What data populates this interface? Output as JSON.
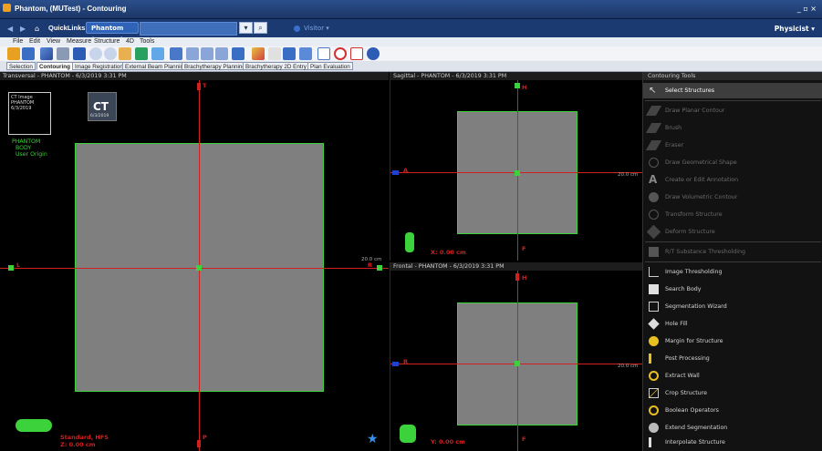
{
  "window": {
    "title": "Phantom, (MUTest) - Contouring",
    "controls": "_ ▫ ×"
  },
  "nav": {
    "quicklinks": "QuickLinks ▾",
    "patient_tab": "Phantom (MUTest)",
    "visitor": "Visitor ▾",
    "user": "Physicist ▾"
  },
  "menu": [
    "File",
    "Edit",
    "View",
    "Measure",
    "Structure",
    "4D",
    "Tools"
  ],
  "task_tabs": [
    "Selection",
    "Contouring",
    "Image Registration",
    "External Beam Planning",
    "Brachytherapy Planning",
    "Brachytherapy 2D Entry",
    "Plan Evaluation"
  ],
  "active_task_tab": "Contouring",
  "viewports": {
    "transversal": {
      "title": "Transversal - PHANTOM - 6/3/2019 3:31 PM",
      "series_thumb_1": "CT Image\nPHANTOM\n6/3/2019",
      "series_thumb_2_label": "CT",
      "series_thumb_2_date": "6/3/2019",
      "structures": [
        "PHANTOM",
        "BODY",
        "User Origin"
      ],
      "scale": "20.0 cm",
      "orientation": "Standard, HFS",
      "z_coord": "Z: 0.00 cm",
      "marker_t": "T",
      "marker_p": "P",
      "marker_l": "L",
      "marker_r": "R"
    },
    "sagittal": {
      "title": "Sagittal - PHANTOM - 6/3/2019 3:31 PM",
      "scale": "20.0 cm",
      "x_coord": "X: 0.00 cm",
      "marker_h": "H",
      "marker_a": "A",
      "marker_f": "F"
    },
    "frontal": {
      "title": "Frontal - PHANTOM - 6/3/2019 3:31 PM",
      "scale": "20.0 cm",
      "y_coord": "Y: 0.00 cm",
      "marker_h": "H",
      "marker_r": "R",
      "marker_f": "F"
    }
  },
  "tools_panel": {
    "title": "Contouring Tools",
    "items": [
      {
        "label": "Select Structures",
        "icon": "arrow-pointer-icon",
        "state": "selected"
      },
      {
        "label": "Draw Planar Contour",
        "icon": "pen-icon",
        "state": "disabled"
      },
      {
        "label": "Brush",
        "icon": "brush-icon",
        "state": "disabled"
      },
      {
        "label": "Eraser",
        "icon": "eraser-icon",
        "state": "disabled"
      },
      {
        "label": "Draw Geometrical Shape",
        "icon": "ellipse-icon",
        "state": "disabled"
      },
      {
        "label": "Create or Edit Annotation",
        "icon": "annotation-icon",
        "state": "disabled"
      },
      {
        "label": "Draw Volumetric Contour",
        "icon": "sphere-brush-icon",
        "state": "disabled"
      },
      {
        "label": "Transform Structure",
        "icon": "transform-icon",
        "state": "disabled"
      },
      {
        "label": "Deform Structure",
        "icon": "deform-icon",
        "state": "disabled"
      },
      {
        "label": "R/T Substance Thresholding",
        "icon": "substance-icon",
        "state": "disabled"
      },
      {
        "label": "Image Thresholding",
        "icon": "histogram-icon",
        "state": "enabled"
      },
      {
        "label": "Search Body",
        "icon": "search-body-icon",
        "state": "enabled"
      },
      {
        "label": "Segmentation Wizard",
        "icon": "wizard-icon",
        "state": "enabled"
      },
      {
        "label": "Hole Fill",
        "icon": "hole-fill-icon",
        "state": "enabled"
      },
      {
        "label": "Margin for Structure",
        "icon": "margin-icon",
        "state": "enabled"
      },
      {
        "label": "Post Processing",
        "icon": "post-processing-icon",
        "state": "enabled"
      },
      {
        "label": "Extract Wall",
        "icon": "extract-wall-icon",
        "state": "enabled"
      },
      {
        "label": "Crop Structure",
        "icon": "crop-icon",
        "state": "enabled"
      },
      {
        "label": "Boolean Operators",
        "icon": "boolean-icon",
        "state": "enabled"
      },
      {
        "label": "Extend Segmentation",
        "icon": "extend-icon",
        "state": "enabled"
      },
      {
        "label": "Interpolate Structure",
        "icon": "interpolate-icon",
        "state": "enabled"
      }
    ]
  },
  "colors": {
    "structure_green": "#3cd23c",
    "crosshair_red": "#d02020",
    "phantom_gray": "#7f7f7f",
    "title_blue": "#1c3666"
  }
}
